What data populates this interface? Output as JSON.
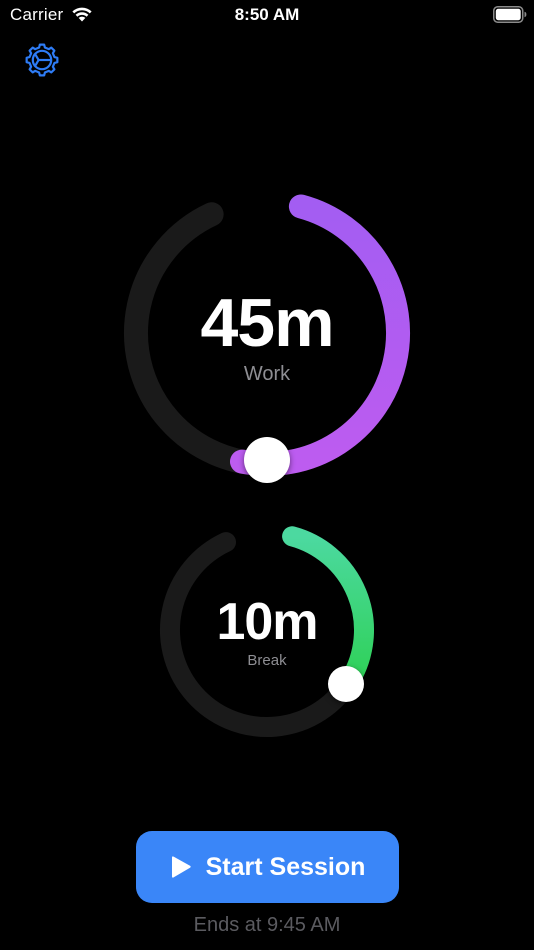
{
  "status_bar": {
    "carrier": "Carrier",
    "time": "8:50 AM",
    "wifi_icon": "wifi-icon",
    "battery_icon": "battery-full-icon"
  },
  "header": {
    "settings_icon": "gear-icon",
    "accent_color": "#2e7cf6"
  },
  "work": {
    "value": "45m",
    "label": "Work",
    "progress_fraction": 0.5,
    "track_color": "#1a1a1a",
    "gradient_start": "#a35df2",
    "gradient_end": "#bd5cf0"
  },
  "break": {
    "value": "10m",
    "label": "Break",
    "progress_fraction": 0.3,
    "track_color": "#1a1a1a",
    "gradient_start": "#4cd9a0",
    "gradient_end": "#2fd158"
  },
  "start_button": {
    "label": "Start Session",
    "icon": "play-icon",
    "color": "#3a86f8"
  },
  "ends_at": "Ends at 9:45 AM"
}
